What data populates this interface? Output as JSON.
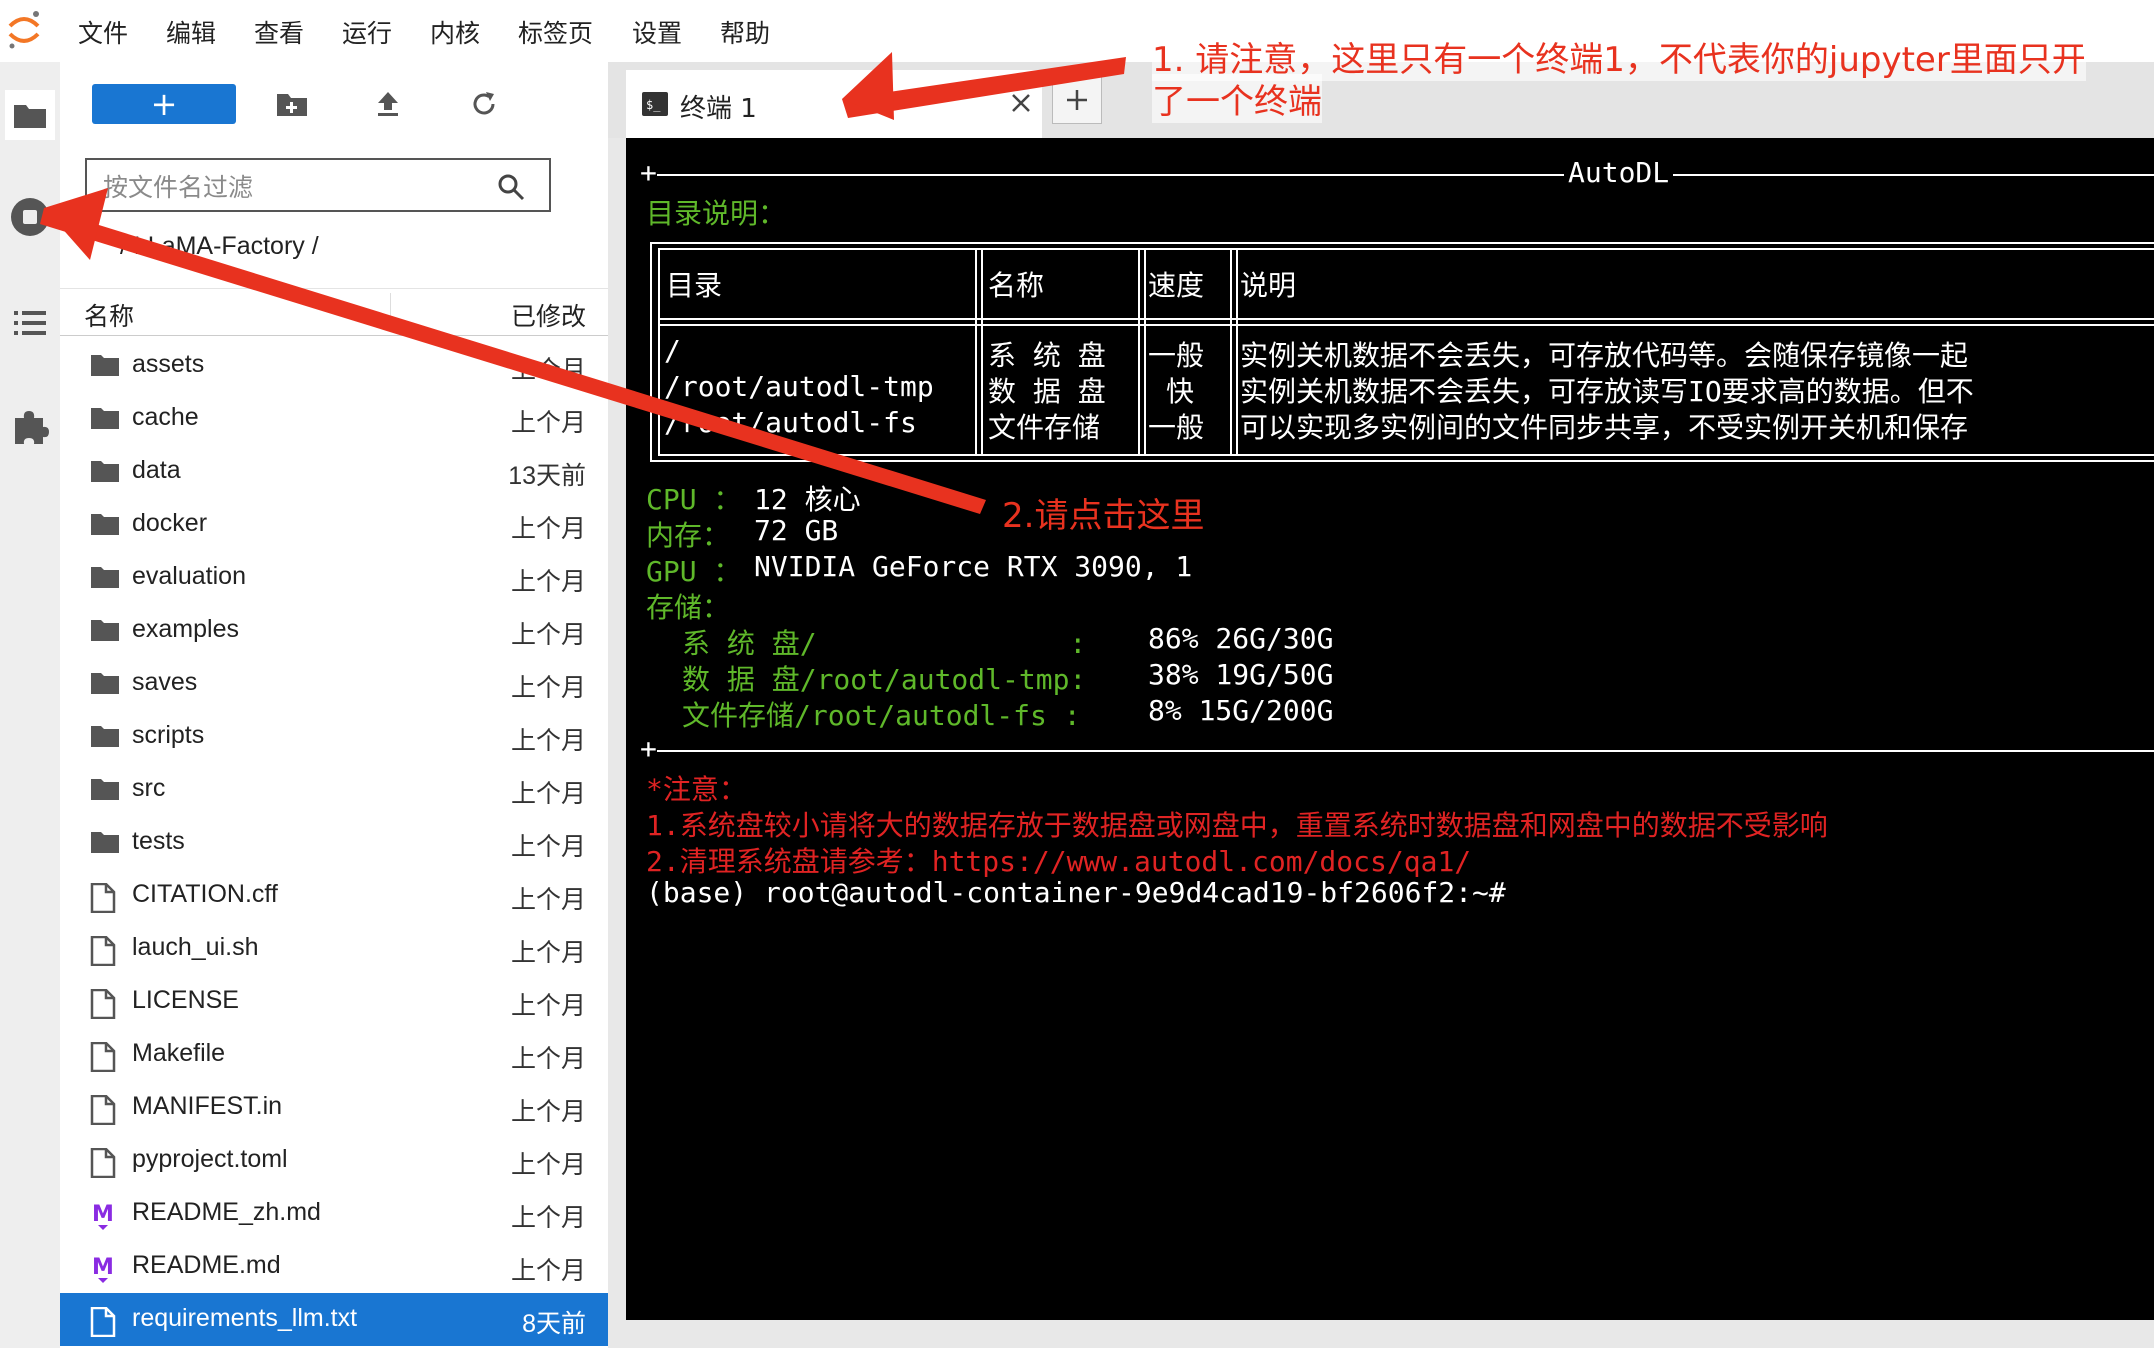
{
  "menu": [
    "文件",
    "编辑",
    "查看",
    "运行",
    "内核",
    "标签页",
    "设置",
    "帮助"
  ],
  "toolbar": {
    "new_label": "+"
  },
  "filter": {
    "placeholder": "按文件名过滤"
  },
  "breadcrumb": "/ LLaMA-Factory /",
  "list": {
    "col_name": "名称",
    "col_modified": "已修改",
    "items": [
      {
        "name": "assets",
        "modified": "上个月",
        "type": "folder"
      },
      {
        "name": "cache",
        "modified": "上个月",
        "type": "folder"
      },
      {
        "name": "data",
        "modified": "13天前",
        "type": "folder"
      },
      {
        "name": "docker",
        "modified": "上个月",
        "type": "folder"
      },
      {
        "name": "evaluation",
        "modified": "上个月",
        "type": "folder"
      },
      {
        "name": "examples",
        "modified": "上个月",
        "type": "folder"
      },
      {
        "name": "saves",
        "modified": "上个月",
        "type": "folder"
      },
      {
        "name": "scripts",
        "modified": "上个月",
        "type": "folder"
      },
      {
        "name": "src",
        "modified": "上个月",
        "type": "folder"
      },
      {
        "name": "tests",
        "modified": "上个月",
        "type": "folder"
      },
      {
        "name": "CITATION.cff",
        "modified": "上个月",
        "type": "file"
      },
      {
        "name": "lauch_ui.sh",
        "modified": "上个月",
        "type": "file"
      },
      {
        "name": "LICENSE",
        "modified": "上个月",
        "type": "file"
      },
      {
        "name": "Makefile",
        "modified": "上个月",
        "type": "file"
      },
      {
        "name": "MANIFEST.in",
        "modified": "上个月",
        "type": "file"
      },
      {
        "name": "pyproject.toml",
        "modified": "上个月",
        "type": "file"
      },
      {
        "name": "README_zh.md",
        "modified": "上个月",
        "type": "markdown"
      },
      {
        "name": "README.md",
        "modified": "上个月",
        "type": "markdown"
      },
      {
        "name": "requirements_llm.txt",
        "modified": "8天前",
        "type": "file",
        "selected": true
      }
    ]
  },
  "tabs": [
    {
      "label": "终端 1"
    }
  ],
  "terminal": {
    "banner_label": "AutoDL",
    "dir_title": "目录说明：",
    "table_headers": [
      "目录",
      "名称",
      "速度",
      "说明"
    ],
    "table_dirs": [
      "/",
      "/root/autodl-tmp",
      "/root/autodl-fs"
    ],
    "table_names": [
      "系 统 盘",
      "数 据 盘",
      "文件存储"
    ],
    "table_speeds": [
      "一般",
      "快",
      "一般"
    ],
    "table_descs": [
      "实例关机数据不会丢失，可存放代码等。会随保存镜像一起",
      "实例关机数据不会丢失，可存放读写IO要求高的数据。但不",
      "可以实现多实例间的文件同步共享，不受实例开关机和保存"
    ],
    "cpu_label": "CPU ：",
    "cpu_value": "12 核心",
    "mem_label": "内存：",
    "mem_value": "72 GB",
    "gpu_label": "GPU ：",
    "gpu_value": "NVIDIA GeForce RTX 3090, 1",
    "storage_label": "存储：",
    "storage": [
      {
        "label": "系 统 盘/               :",
        "value": "86% 26G/30G"
      },
      {
        "label": "数 据 盘/root/autodl-tmp:",
        "value": "38% 19G/50G"
      },
      {
        "label": "文件存储/root/autodl-fs :",
        "value": "8% 15G/200G"
      }
    ],
    "notice_title": "*注意：",
    "notice_1": "1.系统盘较小请将大的数据存放于数据盘或网盘中，重置系统时数据盘和网盘中的数据不受影响",
    "notice_2": "2.清理系统盘请参考：https://www.autodl.com/docs/qa1/",
    "prompt": "(base) root@autodl-container-9e9d4cad19-bf2606f2:~#"
  },
  "annotations": {
    "note1_line1": "1. 请注意，这里只有一个终端1，不代表你的jupyter里面只开",
    "note1_line2": "了一个终端",
    "note2": "2.请点击这里"
  },
  "colors": {
    "accent": "#1976d2",
    "terminal_green": "#5fb82a",
    "terminal_red": "#e02323",
    "annotation": "#e8321f"
  }
}
